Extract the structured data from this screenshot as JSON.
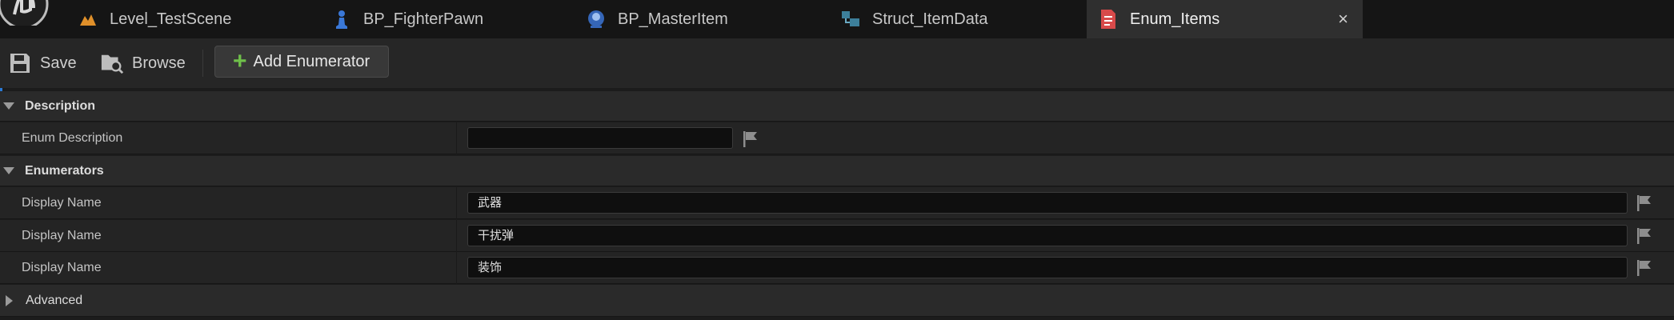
{
  "tabs": [
    {
      "label": "Level_TestScene",
      "icon": "level-icon",
      "active": false
    },
    {
      "label": "BP_FighterPawn",
      "icon": "pawn-icon",
      "active": false
    },
    {
      "label": "BP_MasterItem",
      "icon": "blueprint-icon",
      "active": false
    },
    {
      "label": "Struct_ItemData",
      "icon": "struct-icon",
      "active": false
    },
    {
      "label": "Enum_Items",
      "icon": "enum-icon",
      "active": true,
      "close": "×"
    }
  ],
  "toolbar": {
    "save_label": "Save",
    "browse_label": "Browse",
    "add_enumerator_label": "Add Enumerator",
    "add_icon": "+"
  },
  "details": {
    "description_category": "Description",
    "enum_description_label": "Enum Description",
    "enum_description_value": "",
    "enumerators_category": "Enumerators",
    "enumerators": [
      {
        "label": "Display Name",
        "value": "武器"
      },
      {
        "label": "Display Name",
        "value": "干扰弹"
      },
      {
        "label": "Display Name",
        "value": "装饰"
      }
    ],
    "advanced_category": "Advanced"
  },
  "colors": {
    "accent": "#2a7ad6",
    "add_plus": "#6fc04a",
    "active_tab": "#2f2f2f"
  }
}
